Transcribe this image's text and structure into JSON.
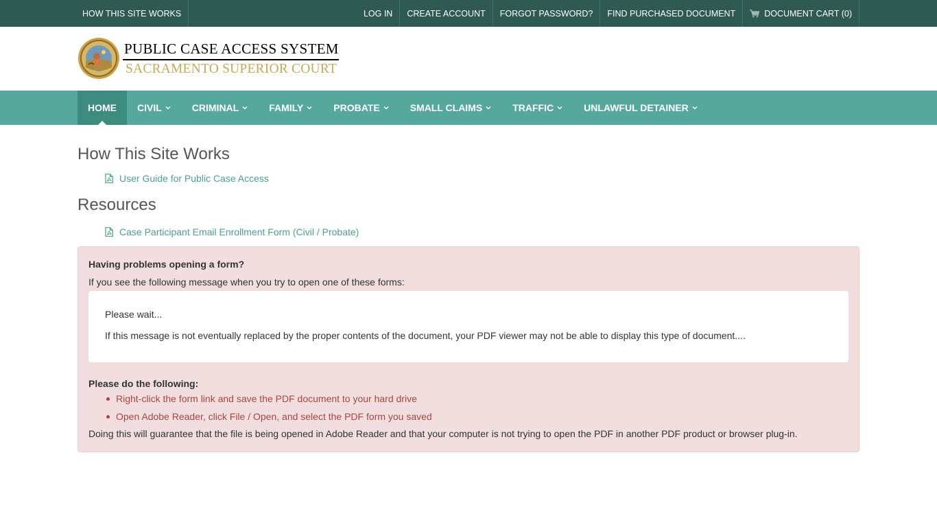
{
  "topbar": {
    "left": [
      "HOW THIS SITE WORKS"
    ],
    "right": [
      "LOG IN",
      "CREATE ACCOUNT",
      "FORGOT PASSWORD?",
      "FIND PURCHASED DOCUMENT",
      "DOCUMENT CART (0)"
    ],
    "cart_icon": "shopping-cart-icon"
  },
  "header": {
    "title": "PUBLIC CASE ACCESS SYSTEM",
    "subtitle": "SACRAMENTO SUPERIOR COURT",
    "seal_icon": "court-seal-icon"
  },
  "nav": {
    "items": [
      {
        "label": "HOME",
        "active": true,
        "dropdown": false
      },
      {
        "label": "CIVIL",
        "active": false,
        "dropdown": true
      },
      {
        "label": "CRIMINAL",
        "active": false,
        "dropdown": true
      },
      {
        "label": "FAMILY",
        "active": false,
        "dropdown": true
      },
      {
        "label": "PROBATE",
        "active": false,
        "dropdown": true
      },
      {
        "label": "SMALL CLAIMS",
        "active": false,
        "dropdown": true
      },
      {
        "label": "TRAFFIC",
        "active": false,
        "dropdown": true
      },
      {
        "label": "UNLAWFUL DETAINER",
        "active": false,
        "dropdown": true
      }
    ]
  },
  "content": {
    "how_title": "How This Site Works",
    "how_link": "User Guide for Public Case Access",
    "resources_title": "Resources",
    "resources_link": "Case Participant Email Enrollment Form (Civil / Probate)"
  },
  "alert": {
    "question": "Having problems opening a form?",
    "intro": "If you see the following message when you try to open one of these forms:",
    "message_line1": "Please wait...",
    "message_line2": "If this message is not eventually replaced by the proper contents of the document, your PDF viewer may not be able to display this type of document....",
    "do_title": "Please do the following:",
    "steps": [
      "Right-click the form link and save the PDF document to your hard drive",
      "Open Adobe Reader, click File / Open, and select the PDF form you saved"
    ],
    "closing": "Doing this will guarantee that the file is being opened in Adobe Reader and that your computer is not trying to open the PDF in another PDF product or browser plug-in."
  },
  "colors": {
    "topbar": "#2e5a52",
    "nav": "#57a89c",
    "nav_active": "#3d8a7e",
    "link": "#4f9e92",
    "alert_bg": "#f2dede",
    "alert_list": "#a94442",
    "subtitle_gold": "#c6a85c"
  }
}
